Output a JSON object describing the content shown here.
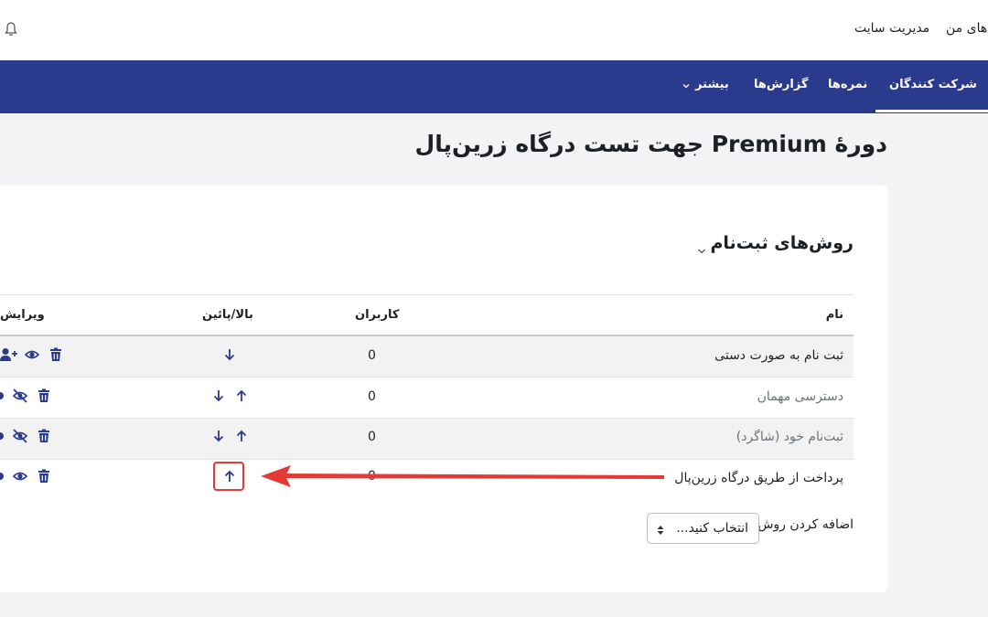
{
  "topbar": {
    "my_courses": "های من",
    "site_admin": "مدیریت سایت",
    "bell_icon": "bell-icon"
  },
  "course_nav": {
    "participants": "شرکت کنندگان",
    "grades": "نمره‌ها",
    "reports": "گزارش‌ها",
    "more": "بیشتر"
  },
  "course_title": "دورهٔ Premium جهت تست درگاه زرین‌پال",
  "enrolment": {
    "section_title": "روش‌های ثبت‌نام",
    "headers": {
      "name": "نام",
      "users": "کاربران",
      "up_down": "بالا/پائین",
      "edit": "ویرایش"
    },
    "rows": [
      {
        "name": "ثبت نام به صورت دستی",
        "users": "0"
      },
      {
        "name": "دسترسی مهمان",
        "users": "0"
      },
      {
        "name": "ثبت‌نام خود (شاگرد)",
        "users": "0"
      },
      {
        "name": "پرداخت از طریق درگاه زرین‌پال",
        "users": "0"
      }
    ],
    "add_method_label": "اضافه کردن روش",
    "add_method_select": "انتخاب کنید..."
  },
  "colors": {
    "navbar": "#2a3a8c",
    "icon": "#2a3a8c",
    "annotation": "#e53935"
  }
}
